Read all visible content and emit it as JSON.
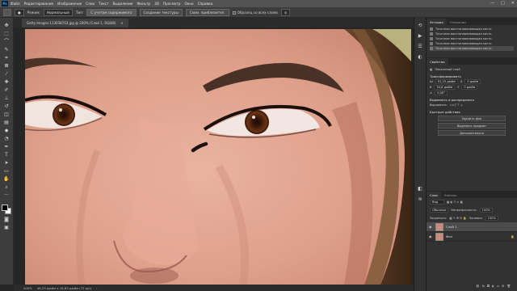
{
  "app": {
    "logo": "Ps"
  },
  "menu": [
    "Файл",
    "Редактирование",
    "Изображение",
    "Слои",
    "Текст",
    "Выделение",
    "Фильтр",
    "3D",
    "Просмотр",
    "Окно",
    "Справка"
  ],
  "options": {
    "mode_label": "Режим:",
    "mode_value": "Нормальный",
    "type_label": "Тип:",
    "btn_content": "С учетом содержимого",
    "btn_texture": "Создание текстуры",
    "btn_match": "Совм. приблизител.",
    "sample_all": "Образец со всех слоев"
  },
  "document": {
    "tab_title": "Getty Images-113038703.jpg @ 200% (Слой 1, RGB/8)",
    "tab_close": "×",
    "zoom": "200%",
    "doc_size": "46,25 дюйм x 16,83 дюйм (72 ppi)"
  },
  "history": {
    "tabs": [
      "История",
      "Операции"
    ],
    "items": [
      "Точечная восстанавливающая кисть",
      "Точечная восстанавливающая кисть",
      "Точечная восстанавливающая кисть",
      "Точечная восстанавливающая кисть",
      "Точечная восстанавливающая кисть"
    ]
  },
  "properties": {
    "tabs": [
      "Свойства"
    ],
    "layer_type": "Пикселный слой",
    "section_transform": "Трансформировать",
    "w": "91,25 дюйм",
    "h": "54,8 дюйм",
    "x": "0 дюйм",
    "y": "0 дюйм",
    "angle": "0,00°",
    "section_align": "Выровнять и распределить",
    "align_label": "Выровнять:",
    "section_quick": "Быстрые действия",
    "btn_remove_bg": "Удалить фон",
    "btn_select_subject": "Выделить предмет",
    "btn_more": "Дополнительно"
  },
  "layers": {
    "tabs": [
      "Слои",
      "Каналы"
    ],
    "filter_label": "Вид",
    "blend": "Обычные",
    "opacity_label": "Непрозрачность:",
    "opacity": "100%",
    "lock_label": "Закрепить:",
    "fill_label": "Заливка:",
    "fill": "100%",
    "items": [
      {
        "name": "Слой 1",
        "selected": true
      },
      {
        "name": "Фон",
        "selected": false
      }
    ]
  }
}
